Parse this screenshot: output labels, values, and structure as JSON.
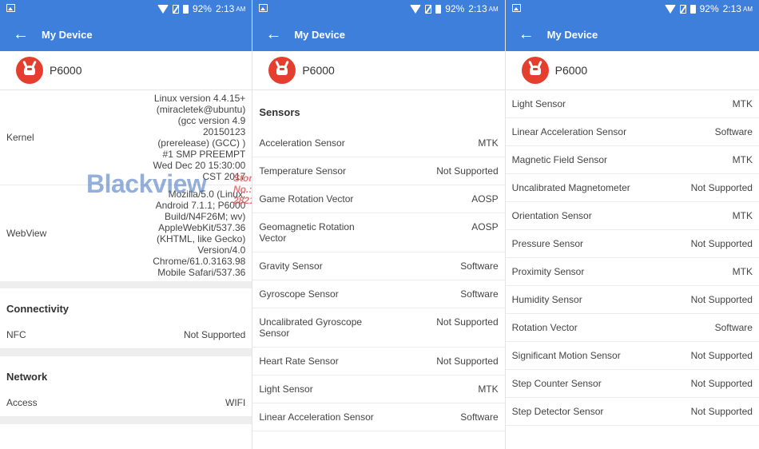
{
  "status": {
    "battery": "92%",
    "time": "2:13",
    "ampm": "AM"
  },
  "appbar": {
    "title": "My Device",
    "back_icon": "arrow-left-icon"
  },
  "device": {
    "name": "P6000",
    "logo_icon": "antutu-logo-icon"
  },
  "watermark": {
    "brand": "Blackview",
    "store_line1": "Store No.:",
    "store_line2": "2821021"
  },
  "panel1": {
    "kernel": {
      "label": "Kernel",
      "value": "Linux version 4.4.15+ (miracletek@ubuntu) (gcc version 4.9 20150123 (prerelease) (GCC) ) #1 SMP PREEMPT Wed Dec 20 15:30:00 CST 2017"
    },
    "webview": {
      "label": "WebView",
      "value": "Mozilla/5.0 (Linux; Android 7.1.1; P6000 Build/N4F26M; wv) AppleWebKit/537.36 (KHTML, like Gecko) Version/4.0 Chrome/61.0.3163.98 Mobile Safari/537.36"
    },
    "connectivity": {
      "header": "Connectivity",
      "rows": [
        {
          "label": "NFC",
          "value": "Not Supported"
        }
      ]
    },
    "network": {
      "header": "Network",
      "rows": [
        {
          "label": "Access",
          "value": "WIFI"
        }
      ]
    }
  },
  "panel2": {
    "header": "Sensors",
    "rows": [
      {
        "label": "Acceleration Sensor",
        "value": "MTK"
      },
      {
        "label": "Temperature Sensor",
        "value": "Not Supported"
      },
      {
        "label": "Game Rotation Vector",
        "value": "AOSP"
      },
      {
        "label": "Geomagnetic Rotation Vector",
        "value": "AOSP"
      },
      {
        "label": "Gravity Sensor",
        "value": "Software"
      },
      {
        "label": "Gyroscope Sensor",
        "value": "Software"
      },
      {
        "label": "Uncalibrated Gyroscope Sensor",
        "value": "Not Supported"
      },
      {
        "label": "Heart Rate Sensor",
        "value": "Not Supported"
      },
      {
        "label": "Light Sensor",
        "value": "MTK"
      },
      {
        "label": "Linear Acceleration Sensor",
        "value": "Software"
      }
    ]
  },
  "panel3": {
    "rows": [
      {
        "label": "Light Sensor",
        "value": "MTK"
      },
      {
        "label": "Linear Acceleration Sensor",
        "value": "Software"
      },
      {
        "label": "Magnetic Field Sensor",
        "value": "MTK"
      },
      {
        "label": "Uncalibrated Magnetometer",
        "value": "Not Supported"
      },
      {
        "label": "Orientation Sensor",
        "value": "MTK"
      },
      {
        "label": "Pressure Sensor",
        "value": "Not Supported"
      },
      {
        "label": "Proximity Sensor",
        "value": "MTK"
      },
      {
        "label": "Humidity Sensor",
        "value": "Not Supported"
      },
      {
        "label": "Rotation Vector",
        "value": "Software"
      },
      {
        "label": "Significant Motion Sensor",
        "value": "Not Supported"
      },
      {
        "label": "Step Counter Sensor",
        "value": "Not Supported"
      },
      {
        "label": "Step Detector Sensor",
        "value": "Not Supported"
      }
    ]
  }
}
